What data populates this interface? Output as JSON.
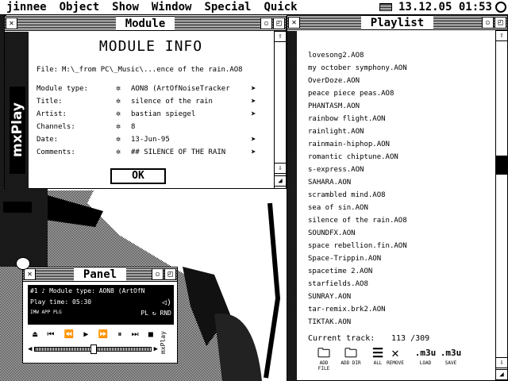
{
  "menubar": {
    "items": [
      "jinnee",
      "Object",
      "Show",
      "Window",
      "Special",
      "Quick"
    ],
    "clock": "13.12.05 01:53"
  },
  "desktop": {
    "vertical_label": "mxPlay"
  },
  "module": {
    "title": "Module",
    "heading": "MODULE INFO",
    "file_label": "File:",
    "file_value": "M:\\_from PC\\_Music\\...ence of the rain.AO8",
    "rows": [
      {
        "label": "Module type:",
        "value": "AON8 (ArtOfNoiseTracker"
      },
      {
        "label": "Title:",
        "value": "silence of the rain"
      },
      {
        "label": "Artist:",
        "value": "bastian spiegel"
      },
      {
        "label": "Channels:",
        "value": "8"
      },
      {
        "label": "Date:",
        "value": "13-Jun-95"
      },
      {
        "label": "Comments:",
        "value": "## SILENCE OF THE RAIN"
      }
    ],
    "ok_label": "OK"
  },
  "playlist": {
    "title": "Playlist",
    "items": [
      "lovesong2.AO8",
      "my october symphony.AON",
      "OverDoze.AON",
      "peace piece peas.AO8",
      "PHANTASM.AON",
      "rainbow flight.AON",
      "rainlight.AON",
      "rainmain-hiphop.AON",
      "romantic chiptune.AON",
      "s-express.AON",
      "SAHARA.AON",
      "scrambled mind.AO8",
      "sea of sin.AON",
      "silence of the rain.AO8",
      "SOUNDFX.AON",
      "space rebellion.fin.AON",
      "Space-Trippin.AON",
      "spacetime 2.AON",
      "starfields.AO8",
      "SUNRAY.AON",
      "tar-remix.brk2.AON",
      "TIKTAK.AON"
    ],
    "current_label": "Current track:",
    "current_value": "113 /309",
    "tools": [
      {
        "icon": "folder",
        "label": "ADD FILE"
      },
      {
        "icon": "folder",
        "label": "ADD DIR"
      },
      {
        "icon": "list",
        "label": "ALL"
      },
      {
        "icon": "x",
        "label": "REMOVE"
      },
      {
        "icon": ".m3u",
        "label": "LOAD"
      },
      {
        "icon": ".m3u",
        "label": "SAVE"
      }
    ]
  },
  "panel": {
    "title": "Panel",
    "line1": "#1 ♪ Module type: AON8 (ArtOfN",
    "line2_label": "Play time:",
    "line2_value": "05:30",
    "modes": [
      "IMW",
      "APP",
      "PLG"
    ],
    "right_modes": [
      "PL",
      "RND"
    ],
    "side_label": "mxPlay"
  }
}
